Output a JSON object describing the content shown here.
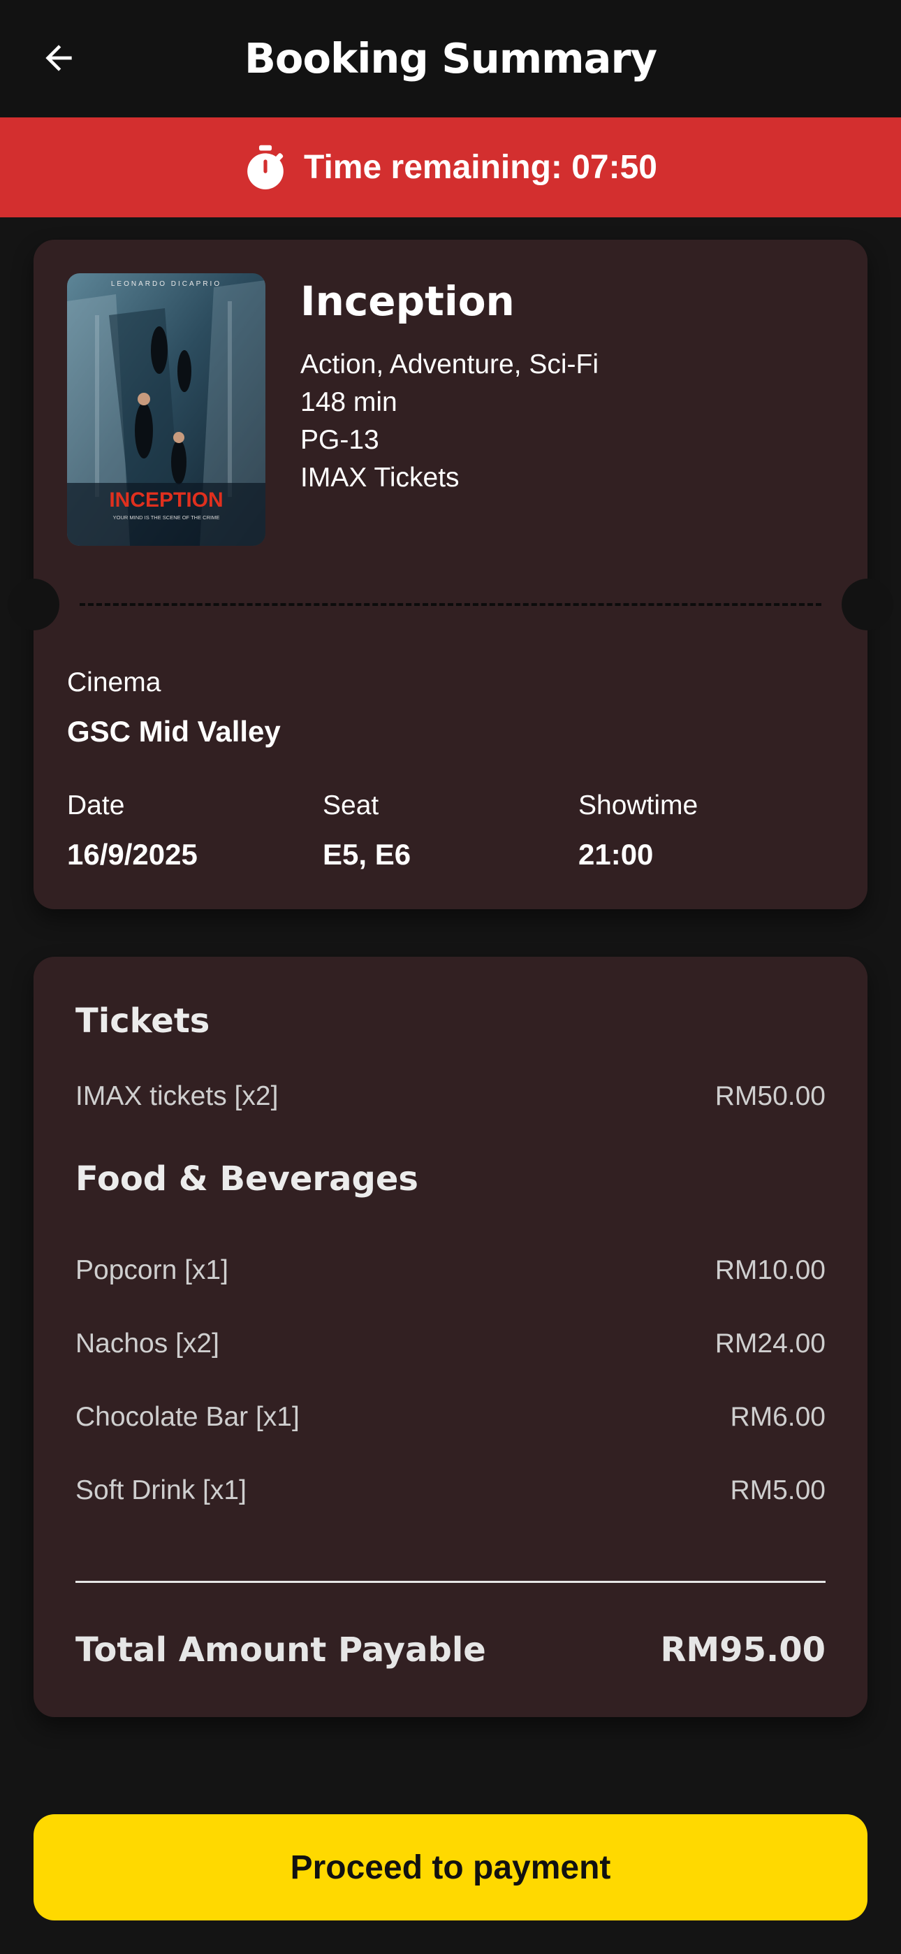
{
  "header": {
    "title": "Booking Summary",
    "back_icon": "arrow-left-icon"
  },
  "timer": {
    "icon": "stopwatch-icon",
    "text": "Time remaining: 07:50"
  },
  "movie": {
    "title": "Inception",
    "genres": "Action, Adventure, Sci-Fi",
    "duration": "148 min",
    "rating": "PG-13",
    "ticket_type": "IMAX Tickets",
    "poster": {
      "top_credit": "LEONARDO DICAPRIO",
      "title_text": "INCEPTION",
      "tagline": "YOUR MIND IS THE SCENE OF THE CRIME"
    }
  },
  "booking": {
    "cinema_label": "Cinema",
    "cinema_value": "GSC Mid Valley",
    "date_label": "Date",
    "date_value": "16/9/2025",
    "seat_label": "Seat",
    "seat_value": "E5, E6",
    "showtime_label": "Showtime",
    "showtime_value": "21:00"
  },
  "summary": {
    "tickets_heading": "Tickets",
    "tickets": [
      {
        "label": "IMAX tickets [x2]",
        "price": "RM50.00"
      }
    ],
    "food_heading": "Food & Beverages",
    "food": [
      {
        "label": "Popcorn [x1]",
        "price": "RM10.00"
      },
      {
        "label": "Nachos [x2]",
        "price": "RM24.00"
      },
      {
        "label": "Chocolate Bar [x1]",
        "price": "RM6.00"
      },
      {
        "label": "Soft Drink [x1]",
        "price": "RM5.00"
      }
    ],
    "total_label": "Total Amount Payable",
    "total_value": "RM95.00"
  },
  "actions": {
    "proceed_label": "Proceed to payment"
  },
  "colors": {
    "background": "#141414",
    "timer_banner": "#d32f2f",
    "card": "#322022",
    "button": "#ffd900"
  }
}
